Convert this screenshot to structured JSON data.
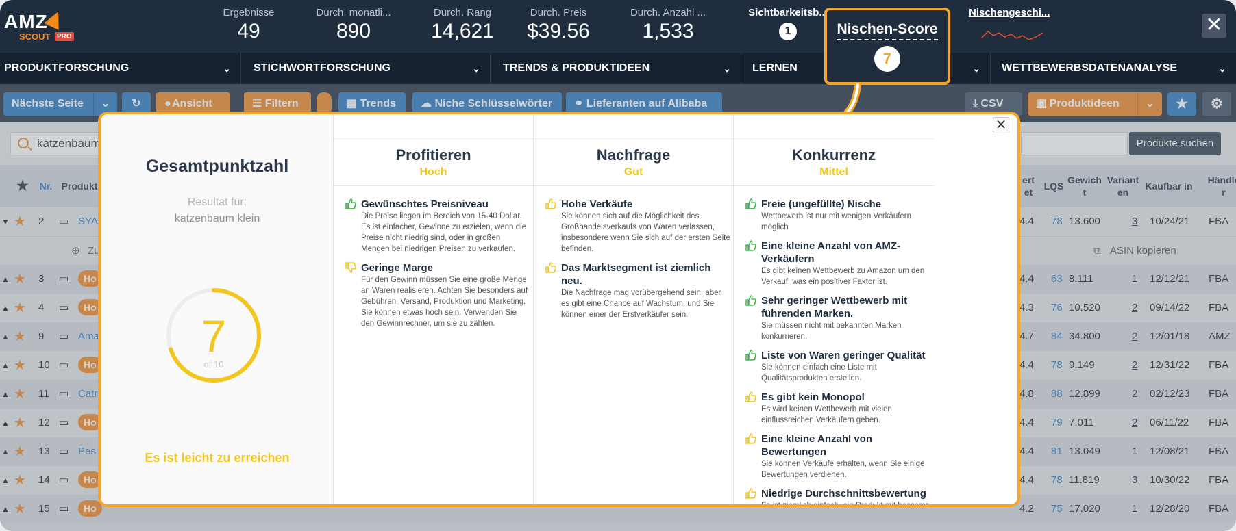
{
  "header": {
    "logo": {
      "amz": "AMZ",
      "scout": "SCOUT",
      "pro": "PRO"
    },
    "stats": [
      {
        "label": "Ergebnisse",
        "value": "49"
      },
      {
        "label": "Durch. monatli...",
        "value": "890"
      },
      {
        "label": "Durch. Rang",
        "value": "14,621"
      },
      {
        "label": "Durch. Preis",
        "value": "$39.56"
      },
      {
        "label": "Durch. Anzahl ...",
        "value": "1,533"
      }
    ],
    "visibility": {
      "label": "Sichtbarkeitsb...",
      "value": "1"
    },
    "niche_history": "Nischengeschi...",
    "close": "✕"
  },
  "callout": {
    "title": "Nischen-Score",
    "value": "7"
  },
  "menu": [
    "PRODUKTFORSCHUNG",
    "STICHWORTFORSCHUNG",
    "TRENDS & PRODUKTIDEEN",
    "LERNEN",
    "WETTBEWERBSDATENANALYSE"
  ],
  "toolbar": {
    "next_page": "Nächste Seite",
    "view": "Ansicht",
    "filter": "Filtern",
    "trends": "Trends",
    "niche_keywords": "Niche Schlüsselwörter",
    "alibaba": "Lieferanten auf Alibaba",
    "csv": "CSV",
    "product_ideas": "Produktideen"
  },
  "search": {
    "value": "katzenbaum",
    "button": "Produkte suchen"
  },
  "table": {
    "headers": {
      "nr": "Nr.",
      "product": "Produkt",
      "rating_tail": "ert\net",
      "lqs": "LQS",
      "weight": "Gewich\nt",
      "variants": "Variant\nen",
      "available": "Kaufbar in",
      "seller": "Händle\nr"
    },
    "sub_row": {
      "add": "Zu",
      "copy": "ASIN kopieren"
    },
    "rows": [
      {
        "nr": "2",
        "name": "SYA",
        "rating": "4.4",
        "lqs": "78",
        "weight": "13.600",
        "variants": "3",
        "date": "10/24/21",
        "seller": "FBA"
      },
      {
        "nr": "3",
        "name": "Ho",
        "rating": "4.4",
        "lqs": "63",
        "weight": "8.111",
        "variants": "1",
        "date": "12/12/21",
        "seller": "FBA"
      },
      {
        "nr": "4",
        "name": "Ho",
        "rating": "4.3",
        "lqs": "76",
        "weight": "10.520",
        "variants": "2",
        "date": "09/14/22",
        "seller": "FBA"
      },
      {
        "nr": "9",
        "name": "Ama",
        "rating": "4.7",
        "lqs": "84",
        "weight": "34.800",
        "variants": "2",
        "date": "12/01/18",
        "seller": "AMZ"
      },
      {
        "nr": "10",
        "name": "Ho",
        "rating": "4.4",
        "lqs": "78",
        "weight": "9.149",
        "variants": "2",
        "date": "12/31/22",
        "seller": "FBA"
      },
      {
        "nr": "11",
        "name": "Catr",
        "rating": "4.8",
        "lqs": "88",
        "weight": "12.899",
        "variants": "2",
        "date": "02/12/23",
        "seller": "FBA"
      },
      {
        "nr": "12",
        "name": "Ho",
        "rating": "4.4",
        "lqs": "79",
        "weight": "7.011",
        "variants": "2",
        "date": "06/11/22",
        "seller": "FBA"
      },
      {
        "nr": "13",
        "name": "Pes",
        "rating": "4.4",
        "lqs": "81",
        "weight": "13.049",
        "variants": "1",
        "date": "12/08/21",
        "seller": "FBA"
      },
      {
        "nr": "14",
        "name": "Ho",
        "rating": "4.4",
        "lqs": "78",
        "weight": "11.819",
        "variants": "3",
        "date": "10/30/22",
        "seller": "FBA"
      },
      {
        "nr": "15",
        "name": "Ho",
        "rating": "4.2",
        "lqs": "75",
        "weight": "17.020",
        "variants": "1",
        "date": "12/28/20",
        "seller": "FBA"
      }
    ]
  },
  "modal": {
    "total_title": "Gesamtpunktzahl",
    "result_for": "Resultat für:",
    "keyword": "katzenbaum klein",
    "score": "7",
    "score_of": "of 10",
    "score_fraction": 0.7,
    "reach": "Es ist leicht zu erreichen",
    "close": "✕",
    "columns": [
      {
        "title": "Profitieren",
        "rating": "Hoch",
        "items": [
          {
            "icon": "thumbs-up",
            "color": "#3fb34f",
            "title": "Gewünschtes Preisniveau",
            "desc": "Die Preise liegen im Bereich von 15-40 Dollar. Es ist einfacher, Gewinne zu erzielen, wenn die Preise nicht niedrig sind, oder in großen Mengen bei niedrigen Preisen zu verkaufen."
          },
          {
            "icon": "thumbs-down",
            "color": "#f2c51f",
            "title": "Geringe Marge",
            "desc": "Für den Gewinn müssen Sie eine große Menge an Waren realisieren. Achten Sie besonders auf Gebühren, Versand, Produktion und Marketing. Sie können etwas hoch sein. Verwenden Sie den Gewinnrechner, um sie zu zählen."
          }
        ]
      },
      {
        "title": "Nachfrage",
        "rating": "Gut",
        "items": [
          {
            "icon": "thumbs-up",
            "color": "#f2c51f",
            "title": "Hohe Verkäufe",
            "desc": "Sie können sich auf die Möglichkeit des Großhandelsverkaufs von Waren verlassen, insbesondere wenn Sie sich auf der ersten Seite befinden."
          },
          {
            "icon": "thumbs-up",
            "color": "#f2c51f",
            "title": "Das Marktsegment ist ziemlich neu.",
            "desc": "Die Nachfrage mag vorübergehend sein, aber es gibt eine Chance auf Wachstum, und Sie können einer der Erstverkäufer sein."
          }
        ]
      },
      {
        "title": "Konkurrenz",
        "rating": "Mittel",
        "items": [
          {
            "icon": "thumbs-up",
            "color": "#3fb34f",
            "title": "Freie (ungefüllte) Nische",
            "desc": "Wettbewerb ist nur mit wenigen Verkäufern möglich"
          },
          {
            "icon": "thumbs-up",
            "color": "#3fb34f",
            "title": "Eine kleine Anzahl von AMZ-Verkäufern",
            "desc": "Es gibt keinen Wettbewerb zu Amazon um den Verkauf, was ein positiver Faktor ist."
          },
          {
            "icon": "thumbs-up",
            "color": "#3fb34f",
            "title": "Sehr geringer Wettbewerb mit führenden Marken.",
            "desc": "Sie müssen nicht mit bekannten Marken konkurrieren."
          },
          {
            "icon": "thumbs-up",
            "color": "#3fb34f",
            "title": "Liste von Waren geringer Qualität",
            "desc": "Sie können einfach eine Liste mit Qualitätsprodukten erstellen."
          },
          {
            "icon": "thumbs-up",
            "color": "#f2c51f",
            "title": "Es gibt kein Monopol",
            "desc": "Es wird keinen Wettbewerb mit vielen einflussreichen Verkäufern geben."
          },
          {
            "icon": "thumbs-up",
            "color": "#f2c51f",
            "title": "Eine kleine Anzahl von Bewertungen",
            "desc": "Sie können Verkäufe erhalten, wenn Sie einige Bewertungen verdienen."
          },
          {
            "icon": "thumbs-up",
            "color": "#f2c51f",
            "title": "Niedrige Durchschnittsbewertung",
            "desc": "Es ist ziemlich einfach, ein Produkt mit besserer Qualität zu erstellen."
          }
        ]
      }
    ]
  },
  "colors": {
    "accent": "#f4a62a",
    "dark": "#1f2d3e",
    "blue": "#2f7cc2",
    "orange": "#ef8b2c",
    "green": "#3fb34f",
    "yellow": "#f2c51f"
  }
}
